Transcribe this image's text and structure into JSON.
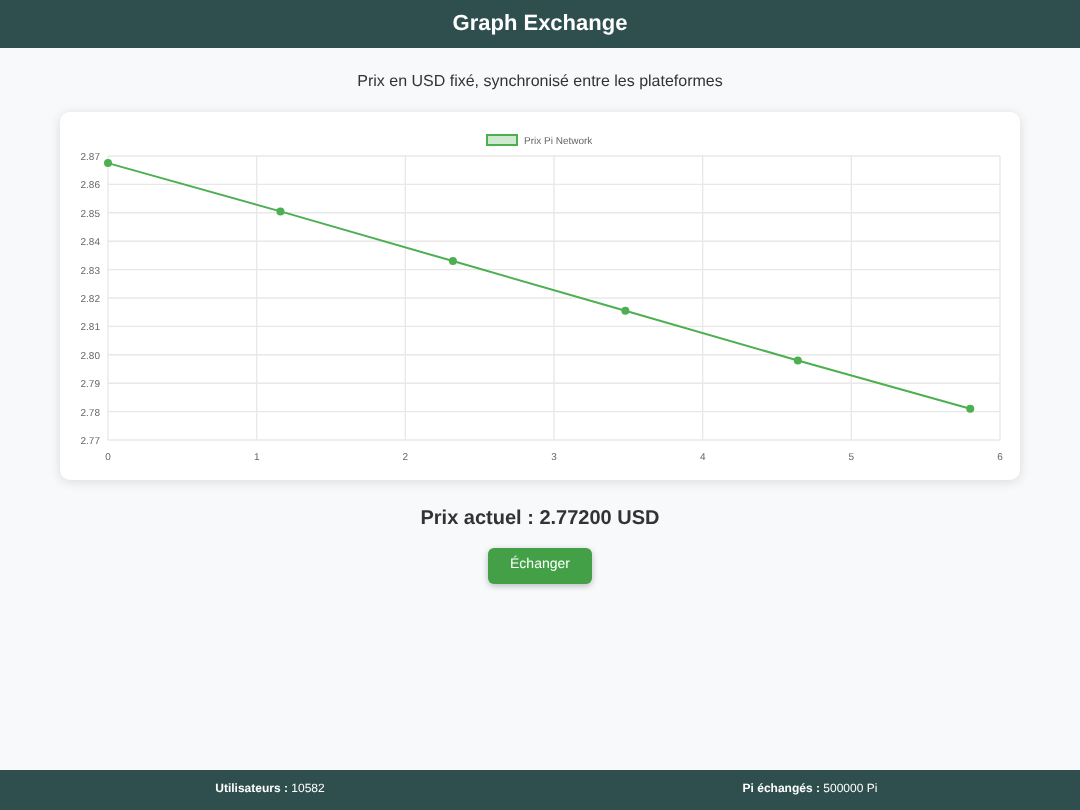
{
  "header": {
    "title": "Graph Exchange"
  },
  "subtitle": "Prix en USD fixé, synchronisé entre les plateformes",
  "chart": {
    "chart_data": {
      "type": "line",
      "x": [
        0,
        1.16,
        2.32,
        3.48,
        4.64,
        5.8
      ],
      "series": [
        {
          "name": "Prix Pi Network",
          "color": "#4caf50",
          "marker": true,
          "values": [
            2.8675,
            2.8505,
            2.833,
            2.8155,
            2.798,
            2.781
          ]
        }
      ],
      "xlim": [
        0,
        6
      ],
      "ylim": [
        2.77,
        2.87
      ],
      "xticks": [
        0,
        1,
        2,
        3,
        4,
        5,
        6
      ],
      "yticks": [
        2.77,
        2.78,
        2.79,
        {
          "value": 2.8,
          "label": "2.80"
        },
        2.81,
        2.82,
        2.83,
        2.84,
        2.85,
        2.86,
        2.87
      ],
      "grid": true
    }
  },
  "price": "Prix actuel : 2.77200 USD",
  "button": "Échanger",
  "footer": [
    "**Utilisateurs :** 10582",
    "**Pi échangés :** 500000 Pi"
  ]
}
